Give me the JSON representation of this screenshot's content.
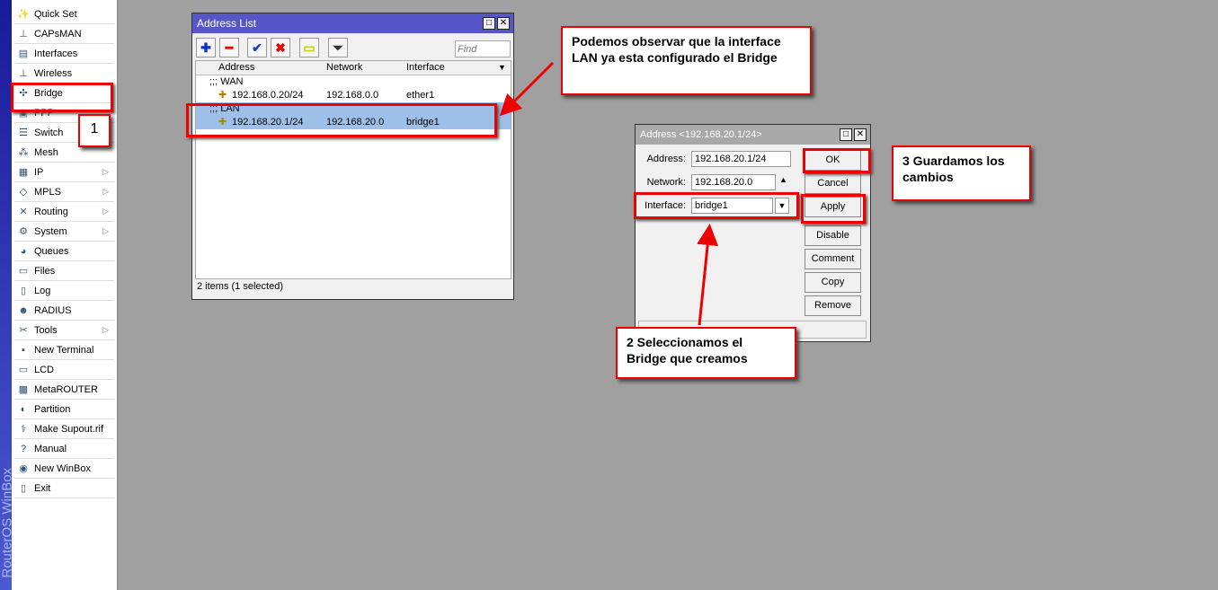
{
  "brand": "RouterOS WinBox",
  "menu": [
    {
      "label": "Quick Set",
      "icon": "wand-icon"
    },
    {
      "label": "CAPsMAN",
      "icon": "antenna-icon"
    },
    {
      "label": "Interfaces",
      "icon": "interfaces-icon"
    },
    {
      "label": "Wireless",
      "icon": "antenna-icon"
    },
    {
      "label": "Bridge",
      "icon": "bridge-icon"
    },
    {
      "label": "PPP",
      "icon": "ppp-icon"
    },
    {
      "label": "Switch",
      "icon": "switch-icon"
    },
    {
      "label": "Mesh",
      "icon": "mesh-icon"
    },
    {
      "label": "IP",
      "icon": "ip-icon",
      "sub": true
    },
    {
      "label": "MPLS",
      "icon": "mpls-icon",
      "sub": true
    },
    {
      "label": "Routing",
      "icon": "routing-icon",
      "sub": true
    },
    {
      "label": "System",
      "icon": "gear-icon",
      "sub": true
    },
    {
      "label": "Queues",
      "icon": "queues-icon"
    },
    {
      "label": "Files",
      "icon": "folder-icon"
    },
    {
      "label": "Log",
      "icon": "log-icon"
    },
    {
      "label": "RADIUS",
      "icon": "radius-icon"
    },
    {
      "label": "Tools",
      "icon": "tools-icon",
      "sub": true
    },
    {
      "label": "New Terminal",
      "icon": "terminal-icon"
    },
    {
      "label": "LCD",
      "icon": "lcd-icon"
    },
    {
      "label": "MetaROUTER",
      "icon": "metarouter-icon"
    },
    {
      "label": "Partition",
      "icon": "partition-icon"
    },
    {
      "label": "Make Supout.rif",
      "icon": "supout-icon"
    },
    {
      "label": "Manual",
      "icon": "help-icon"
    },
    {
      "label": "New WinBox",
      "icon": "winbox-icon"
    },
    {
      "label": "Exit",
      "icon": "exit-icon"
    }
  ],
  "address_list": {
    "title": "Address List",
    "find_placeholder": "Find",
    "columns": [
      "Address",
      "Network",
      "Interface"
    ],
    "rows": [
      {
        "type": "comment",
        "text": ";;; WAN"
      },
      {
        "type": "item",
        "address": "192.168.0.20/24",
        "network": "192.168.0.0",
        "interface": "ether1"
      },
      {
        "type": "comment",
        "text": ";;; LAN",
        "selected": true
      },
      {
        "type": "item",
        "address": "192.168.20.1/24",
        "network": "192.168.20.0",
        "interface": "bridge1",
        "selected": true
      }
    ],
    "status": "2 items (1 selected)"
  },
  "dialog": {
    "title": "Address <192.168.20.1/24>",
    "address_label": "Address:",
    "address": "192.168.20.1/24",
    "network_label": "Network:",
    "network": "192.168.20.0",
    "interface_label": "Interface:",
    "interface": "bridge1",
    "buttons": [
      "OK",
      "Cancel",
      "Apply",
      "Disable",
      "Comment",
      "Copy",
      "Remove"
    ]
  },
  "callouts": {
    "c1": "1",
    "top": "Podemos observar que la interface LAN ya esta configurado el Bridge",
    "c2": "2 Seleccionamos el Bridge que creamos",
    "c3": "3 Guardamos los cambios"
  },
  "colors": {
    "title_bar": "#5656c8",
    "selection": "#9ebfe8",
    "annotation": "#e00000"
  }
}
